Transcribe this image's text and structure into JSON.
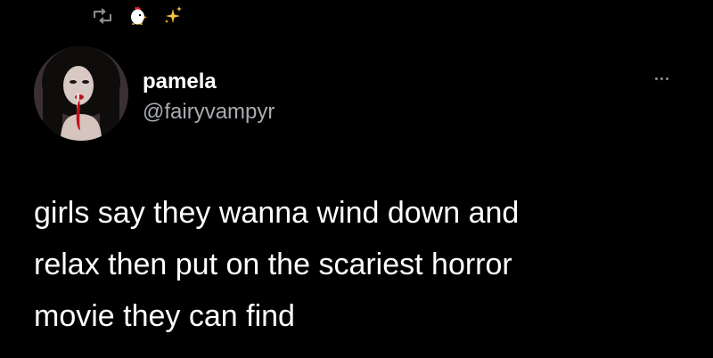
{
  "context": {
    "icons": [
      "retweet-icon",
      "chicken-emoji",
      "sparkles-emoji"
    ]
  },
  "author": {
    "display_name": "pamela",
    "handle": "@fairyvampyr"
  },
  "tweet": {
    "lines": [
      "girls say they wanna wind down and",
      "relax then put on the scariest horror",
      "movie they can find"
    ]
  },
  "colors": {
    "background": "#000000",
    "text": "#ffffff",
    "secondary_text": "#a8acb0",
    "icon": "#8b8f93",
    "sparkle": "#f5c542"
  }
}
